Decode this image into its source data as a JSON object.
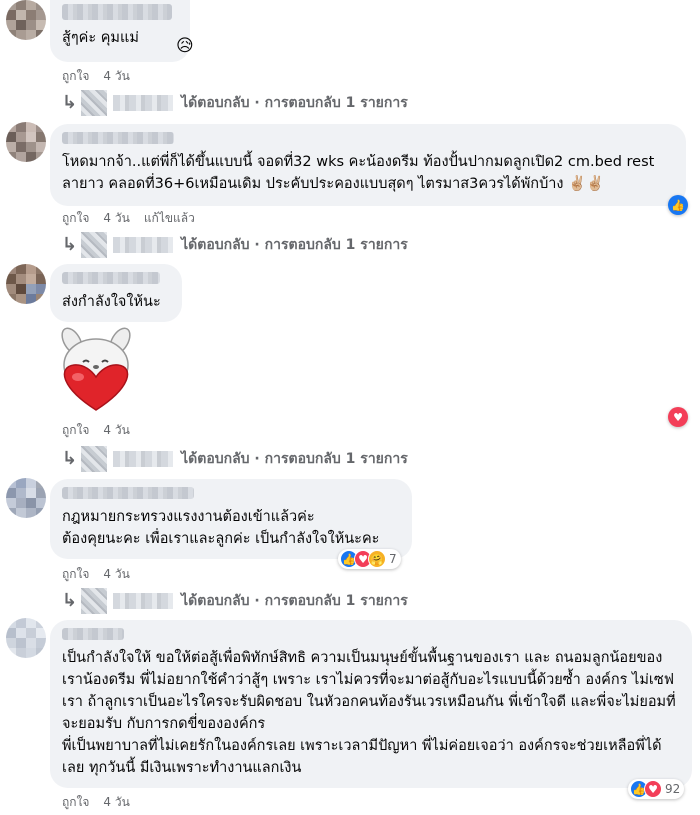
{
  "comments": [
    {
      "text": "สู้ๆค่ะ คุมแม่",
      "reaction_emoji": "😥",
      "actions": [
        "ถูกใจ",
        "4 วัน"
      ],
      "reply_summary": "ได้ตอบกลับ · การตอบกลับ 1 รายการ"
    },
    {
      "text": "โหดมากจ้า..แต่พี่ก็ได้ขึ้นแบบนี้ จอดที่32 wks คะน้องดรีม ท้องปั้นปากมดลูกเปิด2 cm.bed rest ลายาว คลอดที่36+6เหมือนเดิม ประคับประคองแบบสุดๆ ไตรมาส3ควรได้พักบ้าง ✌🏼✌🏼",
      "actions": [
        "ถูกใจ",
        "4 วัน",
        "แก้ไขแล้ว"
      ],
      "reply_summary": "ได้ตอบกลับ · การตอบกลับ 1 รายการ",
      "reaction_icon": "like"
    },
    {
      "text": "ส่งกำลังใจให้นะ",
      "sticker": "bunny-heart-sticker",
      "actions": [
        "ถูกใจ",
        "4 วัน"
      ],
      "reply_summary": "ได้ตอบกลับ · การตอบกลับ 1 รายการ",
      "reaction_icon": "love"
    },
    {
      "text": "กฎหมายกระทรวงแรงงานต้องเข้าแล้วค่ะ\nต้องคุยนะคะ เพื่อเราและลูกค่ะ เป็นกำลังใจให้นะคะ",
      "actions": [
        "ถูกใจ",
        "4 วัน"
      ],
      "reply_summary": "ได้ตอบกลับ · การตอบกลับ 1 รายการ",
      "reaction_count": "7"
    },
    {
      "text": "เป็นกำลังใจให้ ขอให้ต่อสู้เพื่อพิทักษ์สิทธิ ความเป็นมนุษย์ขั้นพื้นฐานของเรา และ ถนอมลูกน้อยของเราน้องดรีม พี่ไม่อยากใช้คำว่าสู้ๆ เพราะ เราไม่ควรที่จะมาต่อสู้กับอะไรแบบนี้ด้วยซ้ำ องค์กร ไม่เซฟเรา ถ้าลูกเราเป็นอะไรใครจะรับผิดชอบ ในหัวอกคนท้องรันเวรเหมือนกัน พี่เข้าใจดี และพี่จะไม่ยอมที่จะยอมรับ กับการกดขี่ขององค์กร\nพี่เป็นพยาบาลที่ไม่เคยรักในองค์กรเลย เพราะเวลามีปัญหา พี่ไม่ค่อยเจอว่า องค์กรจะช่วยเหลือพี่ได้เลย ทุกวันนี้ มีเงินเพราะทำงานแลกเงิน",
      "actions": [
        "ถูกใจ",
        "4 วัน"
      ],
      "reaction_count": "92"
    }
  ]
}
